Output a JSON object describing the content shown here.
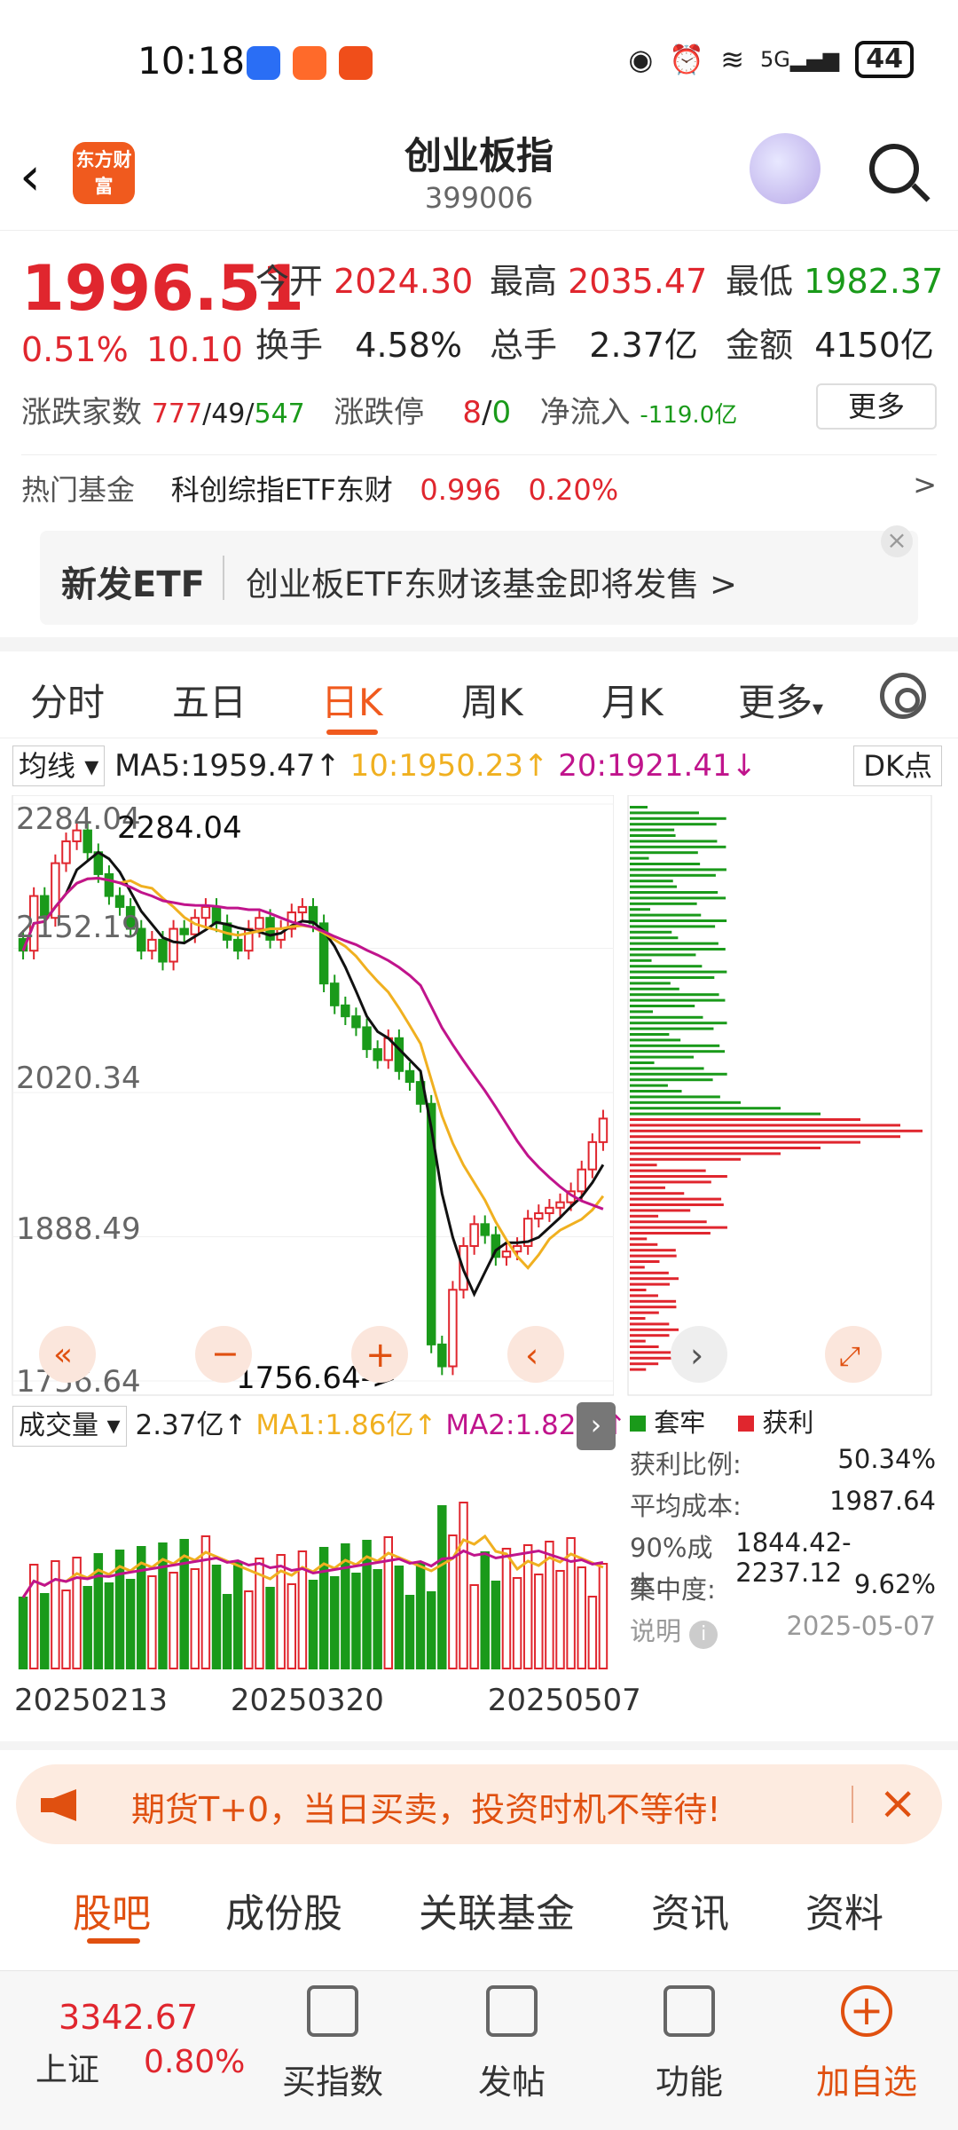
{
  "status_bar": {
    "time": "10:18",
    "battery": "44",
    "network": "5G"
  },
  "header": {
    "title": "创业板指",
    "code": "399006",
    "logo_text": "东方财富"
  },
  "quote": {
    "price": "1996.51",
    "change_pct": "0.51%",
    "change": "10.10",
    "open_label": "今开",
    "open": "2024.30",
    "high_label": "最高",
    "high": "2035.47",
    "low_label": "最低",
    "low": "1982.37",
    "turnover_label": "换手",
    "turnover": "4.58%",
    "volume_label": "总手",
    "volume": "2.37亿",
    "amount_label": "金额",
    "amount": "4150亿",
    "breadth_label": "涨跌家数",
    "up": "777",
    "flat": "49",
    "down": "547",
    "limit_label": "涨跌停",
    "limit_up": "8",
    "limit_down": "0",
    "netflow_label": "净流入",
    "netflow": "-119.0亿",
    "more_label": "更多",
    "hot_fund_label": "热门基金",
    "hot_fund_name": "科创综指ETF东财",
    "hot_fund_price": "0.996",
    "hot_fund_pct": "0.20%"
  },
  "banner": {
    "tag": "新发ETF",
    "text": "创业板ETF东财该基金即将发售 >"
  },
  "ktabs": [
    "分时",
    "五日",
    "日K",
    "周K",
    "月K",
    "更多"
  ],
  "ma_row": {
    "selector": "均线",
    "ma5": "MA5:1959.47",
    "ma10": "10:1950.23",
    "ma20": "20:1921.41",
    "dk": "DK点"
  },
  "axis_labels": [
    "2284.04",
    "2152.19",
    "2020.34",
    "1888.49",
    "1756.64"
  ],
  "annotations": {
    "high": "2284.04",
    "low": "1756.64->"
  },
  "volume_row": {
    "selector": "成交量",
    "vol": "2.37亿",
    "ma1": "MA1:1.86亿",
    "ma2": "MA2:1.82亿"
  },
  "dates": [
    "20250213",
    "20250320",
    "20250507"
  ],
  "chip": {
    "legend_trap": "套牢",
    "legend_profit": "获利",
    "profit_ratio_label": "获利比例:",
    "profit_ratio": "50.34%",
    "avg_cost_label": "平均成本:",
    "avg_cost": "1987.64",
    "cost90_label": "90%成本:",
    "cost90": "1844.42-2237.12",
    "concentration_label": "集中度:",
    "concentration": "9.62%",
    "note_label": "说明",
    "date": "2025-05-07"
  },
  "ad": {
    "text": "期货T+0，当日买卖，投资时机不等待!"
  },
  "bottom_tabs": [
    "股吧",
    "成份股",
    "关联基金",
    "资讯",
    "资料"
  ],
  "dock": {
    "index_price": "3342.67",
    "index_name": "上证",
    "index_pct": "0.80%",
    "items": [
      "买指数",
      "发帖",
      "功能",
      "加自选"
    ]
  },
  "colors": {
    "up": "#e0262e",
    "down": "#1a9a1a",
    "accent": "#f05a1e"
  },
  "chart_data": {
    "type": "candlestick",
    "y_range": [
      1756.64,
      2284.04
    ],
    "ohlc_close": [
      2150,
      2200,
      2180,
      2230,
      2250,
      2260,
      2240,
      2220,
      2200,
      2190,
      2170,
      2150,
      2160,
      2140,
      2170,
      2165,
      2180,
      2190,
      2175,
      2160,
      2150,
      2170,
      2180,
      2160,
      2170,
      2185,
      2190,
      2175,
      2120,
      2100,
      2090,
      2080,
      2060,
      2050,
      2070,
      2040,
      2030,
      2010,
      1790,
      1770,
      1840,
      1880,
      1900,
      1890,
      1870,
      1875,
      1880,
      1905,
      1910,
      1915,
      1920,
      1930,
      1950,
      1975,
      1996.51
    ]
  }
}
